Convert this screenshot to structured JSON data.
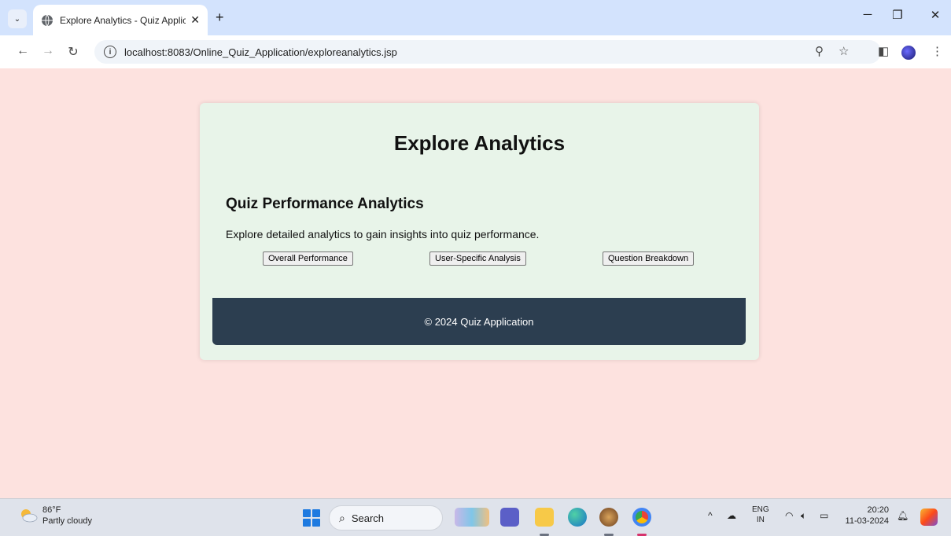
{
  "browser": {
    "tab_title": "Explore Analytics - Quiz Applica",
    "url": "localhost:8083/Online_Quiz_Application/exploreanalytics.jsp"
  },
  "page": {
    "title": "Explore Analytics",
    "section_title": "Quiz Performance Analytics",
    "section_description": "Explore detailed analytics to gain insights into quiz performance.",
    "buttons": [
      {
        "label": "Overall Performance"
      },
      {
        "label": "User-Specific Analysis"
      },
      {
        "label": "Question Breakdown"
      }
    ],
    "footer_text": "© 2024 Quiz Application"
  },
  "taskbar": {
    "weather_temp": "86°F",
    "weather_desc": "Partly cloudy",
    "search_label": "Search",
    "lang_primary": "ENG",
    "lang_region": "IN",
    "time": "20:20",
    "date": "11-03-2024"
  },
  "colors": {
    "page_background": "#fde2df",
    "card_background": "#e8f4e9",
    "footer_background": "#2c3e50",
    "tabstrip": "#d3e3fd"
  }
}
